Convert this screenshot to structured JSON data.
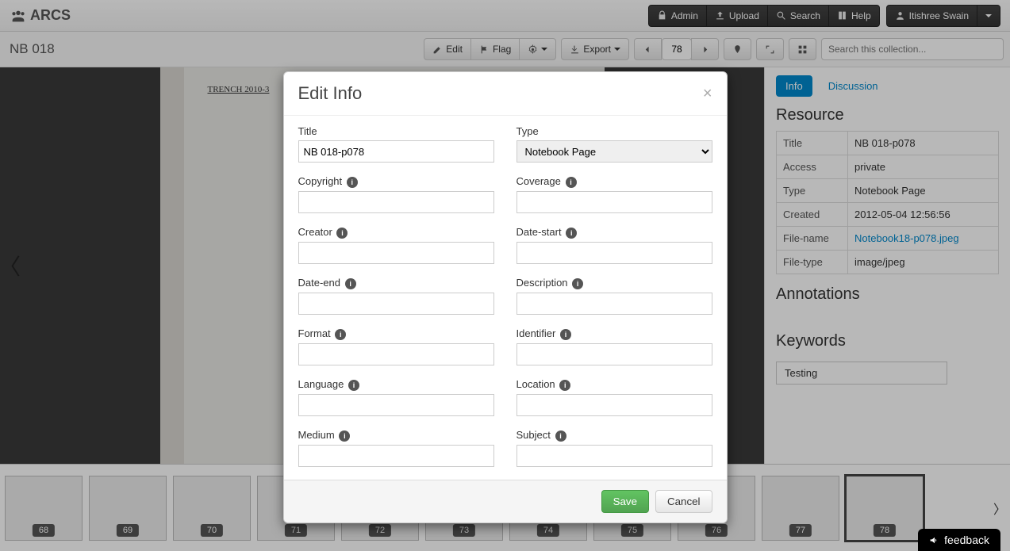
{
  "topnav": {
    "brand": "ARCS",
    "admin": "Admin",
    "upload": "Upload",
    "search": "Search",
    "help": "Help",
    "user": "Itishree Swain"
  },
  "toolbar": {
    "title": "NB 018",
    "edit": "Edit",
    "flag": "Flag",
    "export": "Export",
    "page_num": "78",
    "search_placeholder": "Search this collection..."
  },
  "sidebar": {
    "tabs": {
      "info": "Info",
      "discussion": "Discussion"
    },
    "resource_heading": "Resource",
    "annotations_heading": "Annotations",
    "keywords_heading": "Keywords",
    "meta": {
      "title_label": "Title",
      "title_value": "NB 018-p078",
      "access_label": "Access",
      "access_value": "private",
      "type_label": "Type",
      "type_value": "Notebook Page",
      "created_label": "Created",
      "created_value": "2012-05-04 12:56:56",
      "filename_label": "File-name",
      "filename_value": "Notebook18-p078.jpeg",
      "filetype_label": "File-type",
      "filetype_value": "image/jpeg"
    },
    "keyword_tag": "Testing"
  },
  "thumbs": [
    "68",
    "69",
    "70",
    "71",
    "72",
    "73",
    "74",
    "75",
    "76",
    "77",
    "78"
  ],
  "thumbs_active_index": 10,
  "modal": {
    "heading": "Edit Info",
    "save": "Save",
    "cancel": "Cancel",
    "fields": {
      "title": {
        "label": "Title",
        "value": "NB 018-p078"
      },
      "type": {
        "label": "Type",
        "value": "Notebook Page"
      },
      "copyright": {
        "label": "Copyright",
        "value": ""
      },
      "coverage": {
        "label": "Coverage",
        "value": ""
      },
      "creator": {
        "label": "Creator",
        "value": ""
      },
      "date_start": {
        "label": "Date-start",
        "value": ""
      },
      "date_end": {
        "label": "Date-end",
        "value": ""
      },
      "description": {
        "label": "Description",
        "value": ""
      },
      "format": {
        "label": "Format",
        "value": ""
      },
      "identifier": {
        "label": "Identifier",
        "value": ""
      },
      "language": {
        "label": "Language",
        "value": ""
      },
      "location": {
        "label": "Location",
        "value": ""
      },
      "medium": {
        "label": "Medium",
        "value": ""
      },
      "subject": {
        "label": "Subject",
        "value": ""
      }
    }
  },
  "feedback": "feedback"
}
